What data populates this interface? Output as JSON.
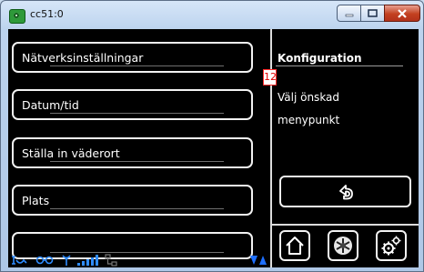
{
  "window": {
    "title": "cc51:0"
  },
  "menu": {
    "items": [
      {
        "label": "Nätverksinställningar"
      },
      {
        "label": "Datum/tid"
      },
      {
        "label": "Ställa in väderort"
      },
      {
        "label": "Plats"
      }
    ]
  },
  "panel": {
    "title": "Konfiguration",
    "badge": "12",
    "info_line1": "Välj önskad",
    "info_line2": "menypunkt"
  },
  "icons": {
    "back": "back-arrow-icon",
    "home": "home-icon",
    "snowflake": "snowflake-icon",
    "settings": "gears-icon",
    "status": [
      "signal-icon",
      "link-icon",
      "antenna-icon",
      "signal-bars-icon",
      "network-icon",
      "scroll-icon"
    ]
  },
  "colors": {
    "accent_blue": "#1e6fff",
    "badge_red": "#e00000"
  }
}
